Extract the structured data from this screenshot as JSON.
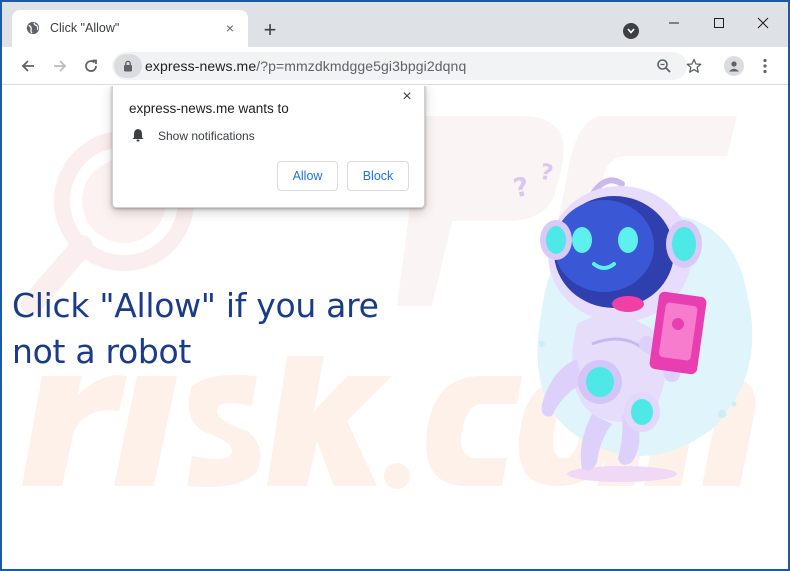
{
  "tab": {
    "title": "Click \"Allow\"",
    "close_glyph": "×",
    "favicon": "globe-icon"
  },
  "tabstrip": {
    "new_tab_glyph": "+"
  },
  "address": {
    "host": "express-news.me",
    "path": "/?p=mmzdkmdgge5gi3bpgi2dqnq"
  },
  "popup": {
    "title": "express-news.me wants to",
    "permission": "Show notifications",
    "allow_label": "Allow",
    "block_label": "Block",
    "close_glyph": "×"
  },
  "page": {
    "headline_line1": "Click \"Allow\" if you are",
    "headline_line2": "not a robot"
  },
  "colors": {
    "frame": "#1c5aa8",
    "headline": "#1a3a8a",
    "button_text": "#1a73e8"
  }
}
